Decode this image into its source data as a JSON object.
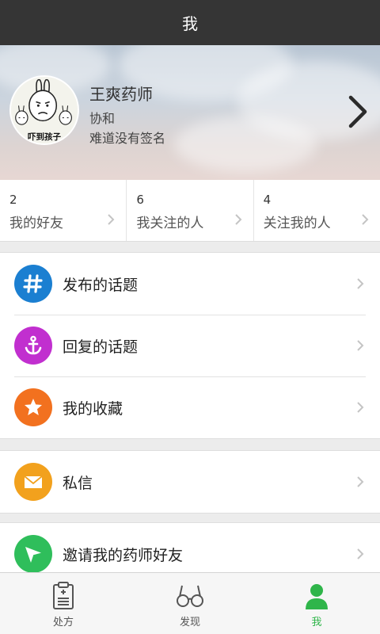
{
  "header": {
    "title": "我"
  },
  "profile": {
    "name": "王爽药师",
    "org": "协和",
    "signature": "难道没有签名",
    "avatar_caption": "吓到孩子"
  },
  "stats": [
    {
      "count": "2",
      "label": "我的好友"
    },
    {
      "count": "6",
      "label": "我关注的人"
    },
    {
      "count": "4",
      "label": "关注我的人"
    }
  ],
  "menu_group1": [
    {
      "label": "发布的话题",
      "icon": "hash-icon",
      "color": "#1b7fd1"
    },
    {
      "label": "回复的话题",
      "icon": "anchor-icon",
      "color": "#c12fcf"
    },
    {
      "label": "我的收藏",
      "icon": "star-icon",
      "color": "#f2711f"
    }
  ],
  "menu_group2": [
    {
      "label": "私信",
      "icon": "mail-icon",
      "color": "#f2a11d"
    }
  ],
  "menu_group3": [
    {
      "label": "邀请我的药师好友",
      "icon": "paper-plane-icon",
      "color": "#2fbe5b"
    }
  ],
  "tabs": [
    {
      "label": "处方",
      "icon": "clipboard-icon",
      "active": false
    },
    {
      "label": "发现",
      "icon": "glasses-icon",
      "active": false
    },
    {
      "label": "我",
      "icon": "person-icon",
      "active": true
    }
  ],
  "colors": {
    "active": "#2fb54a",
    "title_bar": "#353535"
  }
}
